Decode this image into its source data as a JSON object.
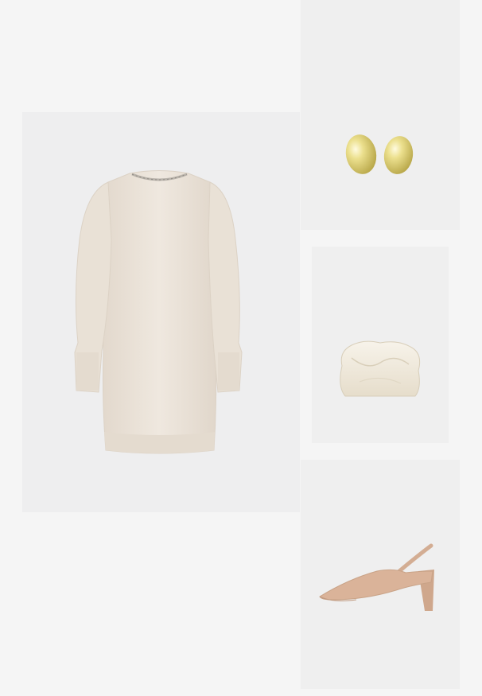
{
  "colors": {
    "page_background": "#f5f5f5",
    "tile_background": "#efefef",
    "dress": "#ebe3d9",
    "earring_gold": "#e2d27a",
    "bag_cream": "#f2ede1",
    "shoe_nude": "#d8b196"
  },
  "products": [
    {
      "id": "dress",
      "icon": "knit-sweater-dress-icon"
    },
    {
      "id": "earring",
      "icon": "gold-dome-earrings-icon"
    },
    {
      "id": "bag",
      "icon": "cream-pouch-clutch-icon"
    },
    {
      "id": "shoe",
      "icon": "nude-slingback-pump-icon"
    }
  ]
}
